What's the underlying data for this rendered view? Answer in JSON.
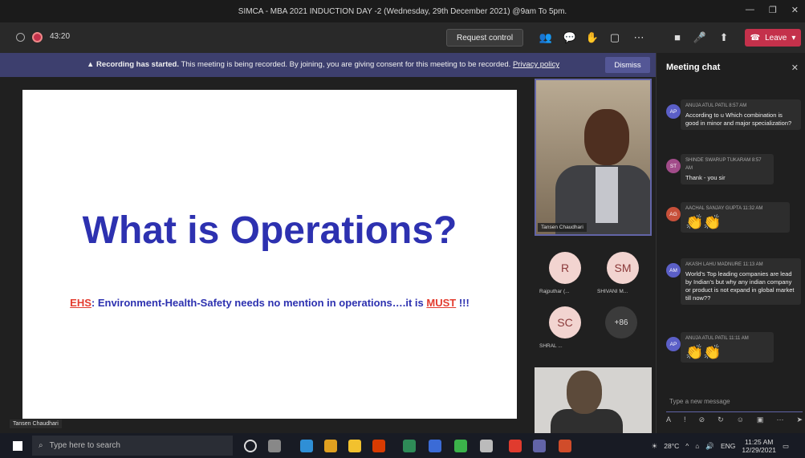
{
  "window": {
    "title": "SIMCA - MBA 2021 INDUCTION DAY -2 (Wednesday, 29th December 2021) @9am To 5pm."
  },
  "toolbar": {
    "timer": "43:20",
    "request_control": "Request control",
    "participants_badge": "86",
    "leave_label": "Leave"
  },
  "banner": {
    "bold": "Recording has started.",
    "text": "This meeting is being recorded. By joining, you are giving consent for this meeting to be recorded.",
    "link": "Privacy policy",
    "dismiss": "Dismiss"
  },
  "slide": {
    "title": "What is Operations?",
    "sub_prefix": "EHS",
    "sub_middle": ": Environment-Health-Safety needs no mention in operations….it is ",
    "sub_emph": "MUST",
    "sub_suffix": " !!!"
  },
  "presenter": {
    "label": "Tansen Chaudhari"
  },
  "video1": {
    "name": "Tansen Chaudhari"
  },
  "participants": [
    {
      "initials": "R",
      "label": "Rajputhar (..."
    },
    {
      "initials": "SM",
      "label": "SHIVANI M..."
    },
    {
      "initials": "SC",
      "label": "SHRAL ..."
    },
    {
      "initials": "+86",
      "label": ""
    }
  ],
  "chat": {
    "title": "Meeting chat",
    "messages": [
      {
        "initials": "AP",
        "color": "#5b5fc7",
        "author": "ANUJA ATUL PATIL",
        "time": "8:57 AM",
        "text": "According to u Which combination is good in minor and major specialization?"
      },
      {
        "initials": "ST",
        "color": "#a24c8a",
        "author": "SHINDE SWARUP TUKARAM",
        "time": "8:57 AM",
        "text": "Thank - you sir"
      },
      {
        "initials": "AG",
        "color": "#c7503a",
        "author": "AACHAL SANJAY GUPTA",
        "time": "11:32 AM",
        "text": "👏👏"
      },
      {
        "initials": "AM",
        "color": "#5b5fc7",
        "author": "AKASH LAHU MADNURE",
        "time": "11:13 AM",
        "text": "World's Top leading companies are lead by Indian's but why any indian company or product is not expand in global market till now??"
      },
      {
        "initials": "AP",
        "color": "#5b5fc7",
        "author": "ANUJA ATUL PATIL",
        "time": "11:11 AM",
        "text": "👏👏"
      }
    ],
    "input_placeholder": "Type a new message"
  },
  "taskbar": {
    "search_placeholder": "Type here to search",
    "temperature": "28°C",
    "language": "ENG",
    "time": "11:25 AM",
    "date": "12/29/2021"
  }
}
